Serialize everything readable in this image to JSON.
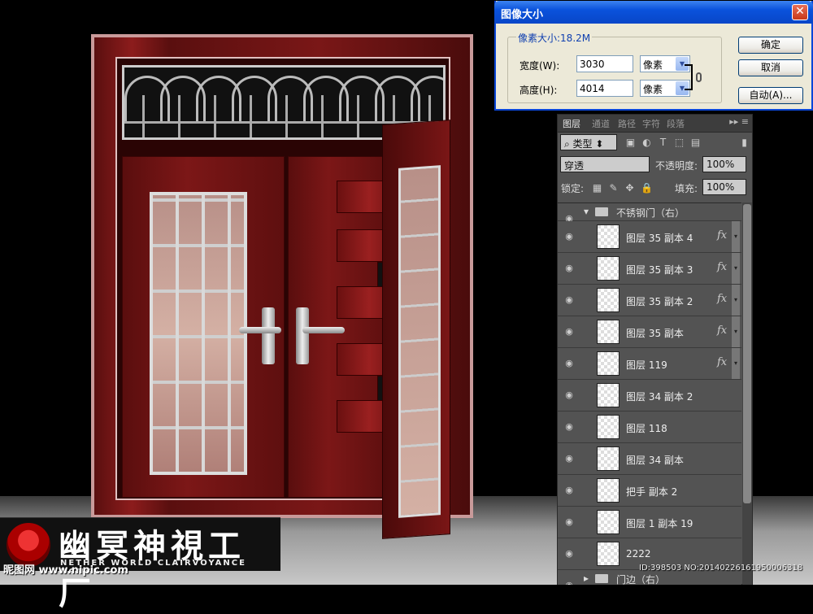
{
  "dialog": {
    "title": "图像大小",
    "pixel_dimensions": "像素大小:18.2M",
    "width_label": "宽度(W):",
    "width_value": "3030",
    "width_unit": "像素",
    "height_label": "高度(H):",
    "height_value": "4014",
    "height_unit": "像素",
    "ok": "确定",
    "cancel": "取消",
    "auto": "自动(A)...",
    "close": "✕"
  },
  "panel": {
    "tabs": [
      "图层",
      "通道",
      "路径",
      "字符",
      "段落"
    ],
    "filter_kind": "类型",
    "blend_mode": "穿透",
    "opacity_label": "不透明度:",
    "opacity_value": "100%",
    "lock_label": "锁定:",
    "fill_label": "填充:",
    "fill_value": "100%",
    "group_name": "不锈钢门（右）",
    "layers": [
      {
        "name": "图层 35 副本 4",
        "fx": true
      },
      {
        "name": "图层 35 副本 3",
        "fx": true
      },
      {
        "name": "图层 35 副本 2",
        "fx": true
      },
      {
        "name": "图层 35 副本",
        "fx": true
      },
      {
        "name": "图层 119",
        "fx": true
      },
      {
        "name": "图层 34 副本 2",
        "fx": false
      },
      {
        "name": "图层 118",
        "fx": false
      },
      {
        "name": "图层 34 副本",
        "fx": false
      },
      {
        "name": "把手 副本 2",
        "fx": false
      },
      {
        "name": "图层 1 副本 19",
        "fx": false
      },
      {
        "name": "2222",
        "fx": false
      }
    ],
    "bottom_group": "门边（右）"
  },
  "logo": {
    "chinese": "幽冥神視工厂",
    "english": "NETHER WORLD CLAIRVOYANCE HOUSE"
  },
  "nipic": "昵图网 www.nipic.com",
  "image_id": "ID:398503 NO:20140226161950006318"
}
